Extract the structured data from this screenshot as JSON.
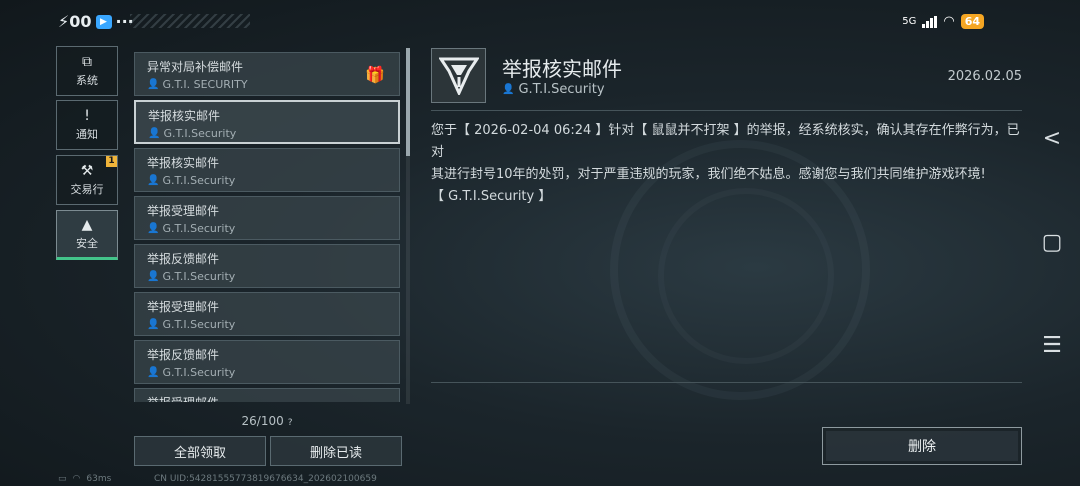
{
  "status_bar": {
    "carrier": "⚡00",
    "network": "5G",
    "battery": "64"
  },
  "categories": [
    {
      "label": "系统",
      "icon": "monitor-icon",
      "glyph": "⧉",
      "badge": ""
    },
    {
      "label": "通知",
      "icon": "notice-icon",
      "glyph": "!",
      "badge": ""
    },
    {
      "label": "交易行",
      "icon": "gavel-icon",
      "glyph": "⚒",
      "badge": "1"
    },
    {
      "label": "安全",
      "icon": "warning-icon",
      "glyph": "▲",
      "badge": ""
    }
  ],
  "mails": [
    {
      "title": "异常对局补偿邮件",
      "sender": "G.T.I. SECURITY",
      "gift": true
    },
    {
      "title": "举报核实邮件",
      "sender": "G.T.I.Security",
      "gift": false
    },
    {
      "title": "举报核实邮件",
      "sender": "G.T.I.Security",
      "gift": false
    },
    {
      "title": "举报受理邮件",
      "sender": "G.T.I.Security",
      "gift": false
    },
    {
      "title": "举报反馈邮件",
      "sender": "G.T.I.Security",
      "gift": false
    },
    {
      "title": "举报受理邮件",
      "sender": "G.T.I.Security",
      "gift": false
    },
    {
      "title": "举报反馈邮件",
      "sender": "G.T.I.Security",
      "gift": false
    },
    {
      "title": "举报受理邮件",
      "sender": "",
      "gift": false
    }
  ],
  "pager": {
    "text": "26/100",
    "help": "?"
  },
  "actions": {
    "claim_all": "全部领取",
    "delete_read": "删除已读",
    "delete": "删除"
  },
  "detail": {
    "title": "举报核实邮件",
    "sender": "G.T.I.Security",
    "date": "2026.02.05",
    "body_line1": "您于【 2026-02-04 06:24 】针对【 鼠鼠并不打架 】的举报，经系统核实，确认其存在作弊行为，已对",
    "body_line2": "其进行封号10年的处罚，对于严重违规的玩家，我们绝不姑息。感谢您与我们共同维护游戏环境!",
    "body_line3": "【 G.T.I.Security 】"
  },
  "footer": {
    "ping": "63ms",
    "uid": "CN UID:5428155577381967663​4_202602100659"
  },
  "system_nav": {
    "back": "<",
    "home": "▢",
    "menu": "☰"
  }
}
